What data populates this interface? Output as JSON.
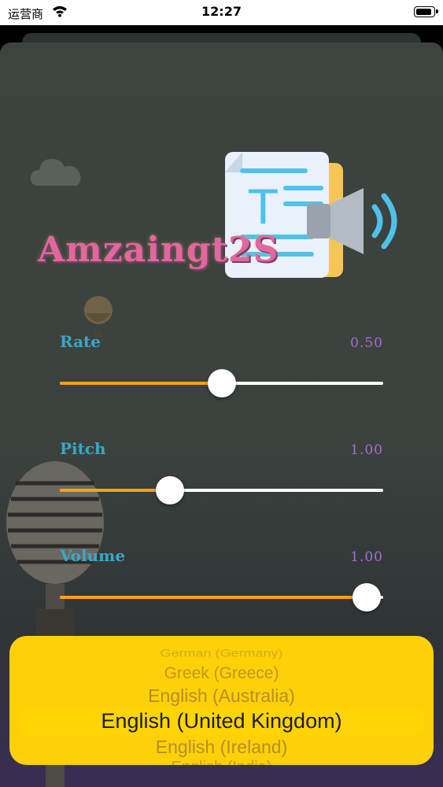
{
  "status_bar": {
    "carrier": "运营商",
    "time": "12:27"
  },
  "app": {
    "title": "Amzaingt2S"
  },
  "sliders": [
    {
      "label": "Rate",
      "value_text": "0.50",
      "fraction": 0.5
    },
    {
      "label": "Pitch",
      "value_text": "1.00",
      "fraction": 0.34
    },
    {
      "label": "Volume",
      "value_text": "1.00",
      "fraction": 0.95
    }
  ],
  "voice_picker": {
    "options": [
      "German (Germany)",
      "Greek (Greece)",
      "English (Australia)",
      "English (United Kingdom)",
      "English (Ireland)",
      "English (India)"
    ],
    "selected_index": 3
  },
  "colors": {
    "accent": "#f7a112",
    "label": "#37a9c8",
    "value": "#a66ed8",
    "picker_bg": "#fdd008"
  },
  "icons": {
    "logo": "text-to-speech-document-speaker-icon",
    "wifi": "wifi-icon",
    "battery": "battery-icon"
  }
}
